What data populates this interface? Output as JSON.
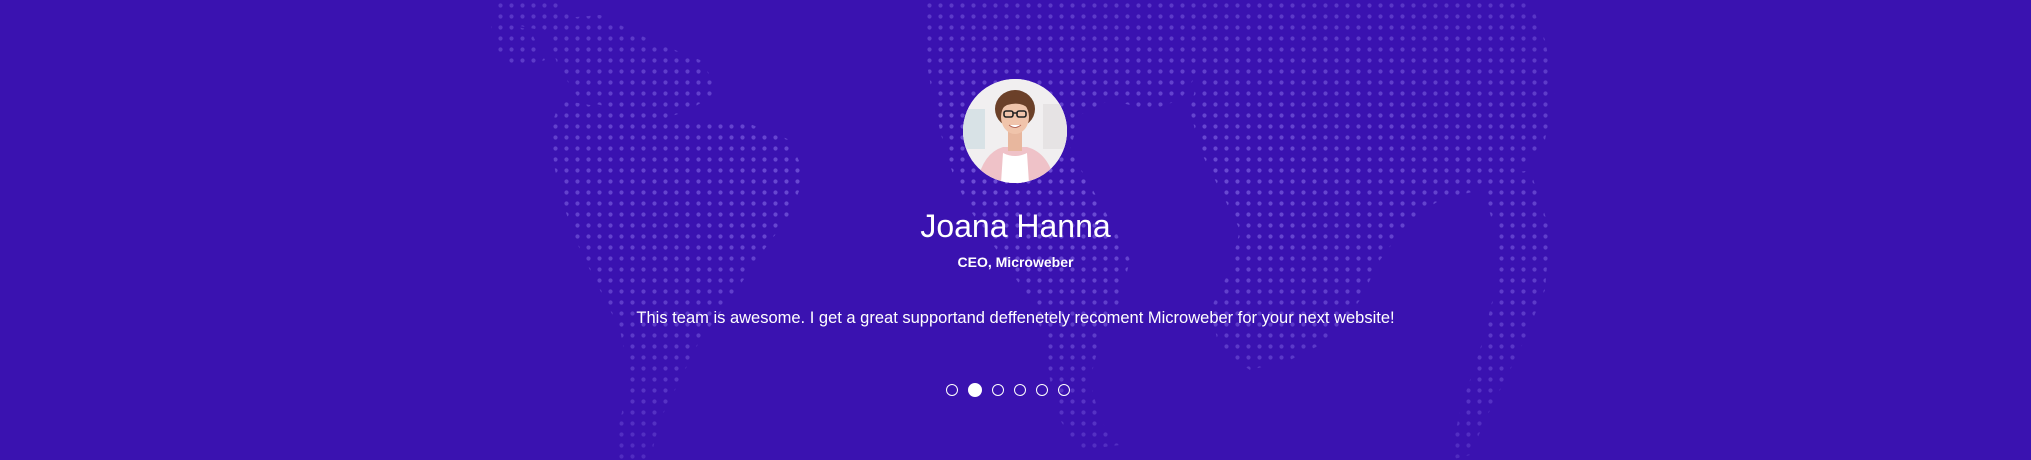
{
  "testimonial": {
    "name": "Joana Hanna",
    "role": "CEO, Microweber",
    "quote": "This team is awesome. I get a great supportand deffenetely recoment Microweber for your next website!"
  },
  "carousel": {
    "total_slides": 6,
    "active_index": 1
  },
  "colors": {
    "background": "#3a12b0",
    "map_dots": "#7a5fe0",
    "text": "#ffffff"
  }
}
